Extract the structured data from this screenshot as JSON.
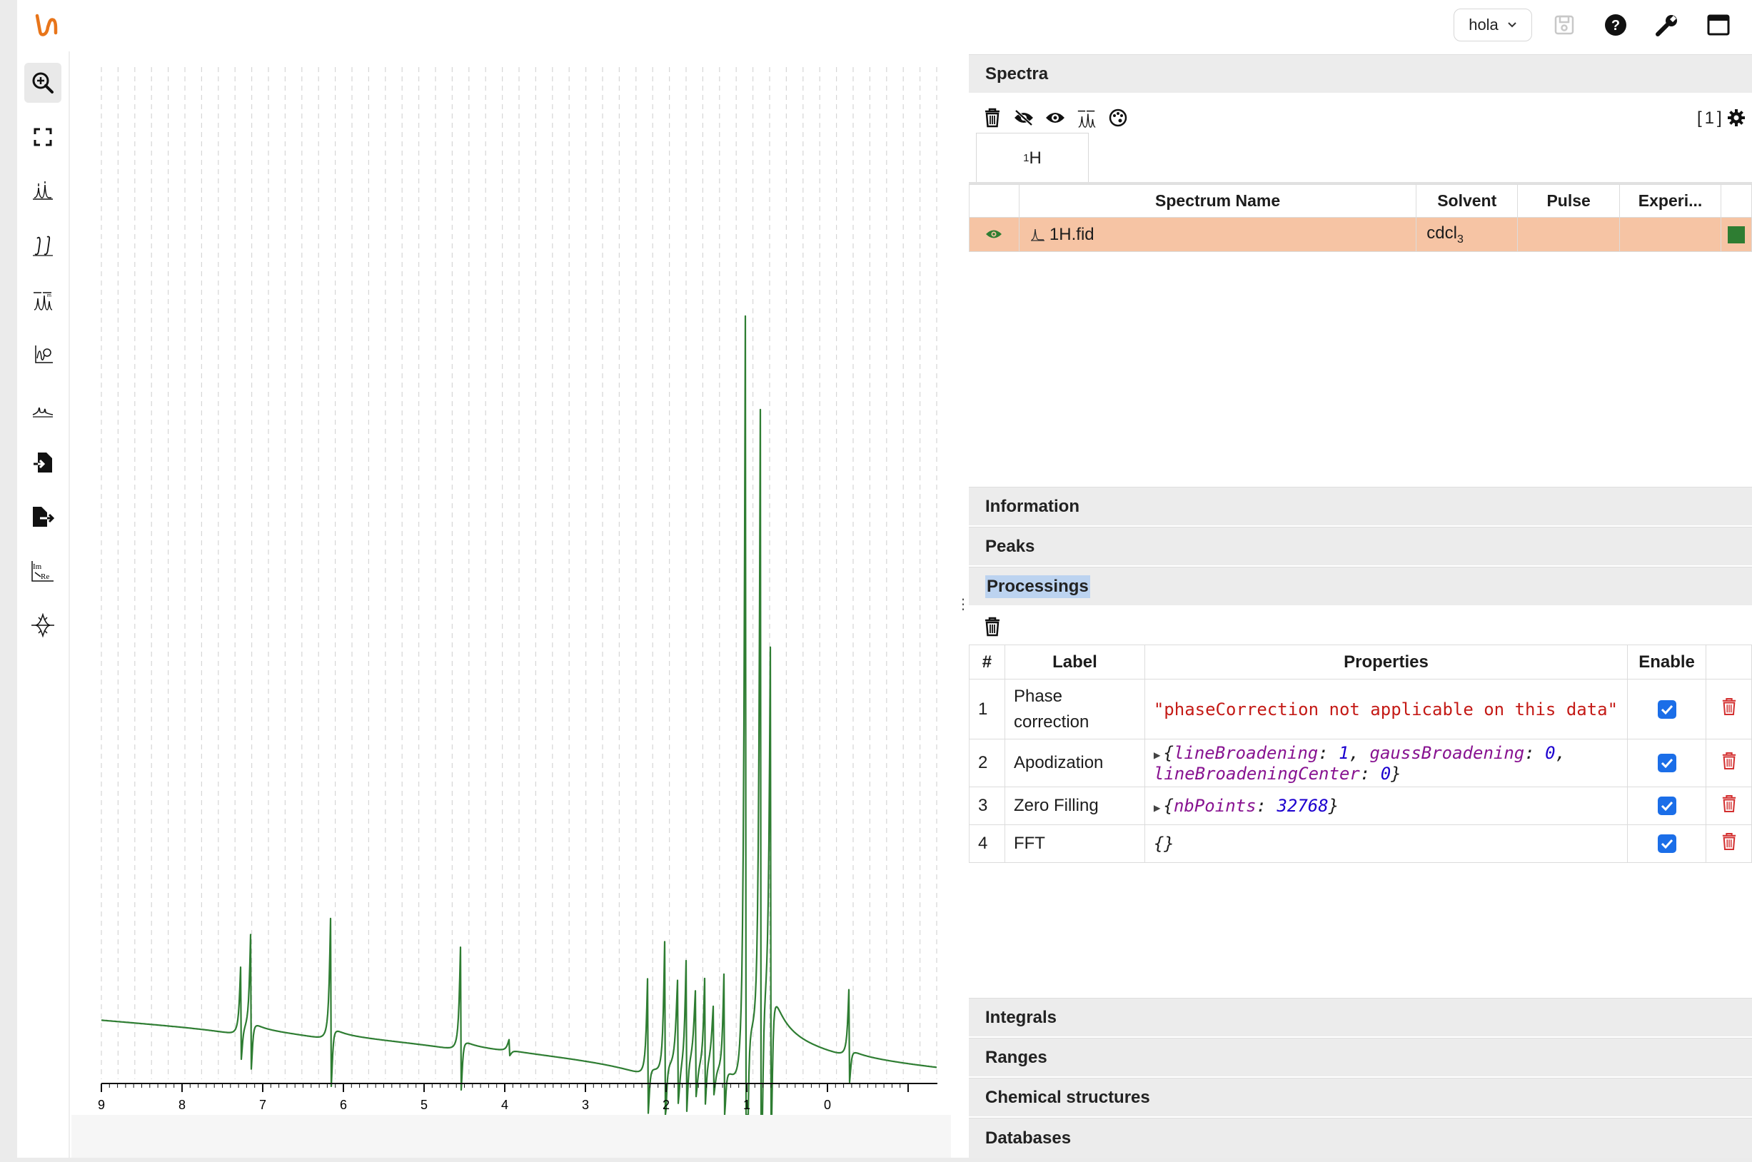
{
  "header": {
    "workspace_label": "hola",
    "icons": [
      "save-icon",
      "help-icon",
      "wrench-icon",
      "window-icon"
    ]
  },
  "toolbar": {
    "tools": [
      "zoom-tool",
      "full-zoom-tool",
      "peak-picking-tool",
      "integral-tool",
      "ranges-tool",
      "phase-correction-tool",
      "baseline-correction-tool",
      "import-tool",
      "export-tool",
      "real-imaginary-tool",
      "zero-filling-tool"
    ]
  },
  "spectrum": {
    "x_ticks": [
      "9",
      "8",
      "7",
      "6",
      "5",
      "4",
      "3",
      "2",
      "1",
      "0"
    ],
    "line_color": "#2e7d32"
  },
  "spectra_panel": {
    "title": "Spectra",
    "count": "[1]",
    "tab_nucleus_sup": "1",
    "tab_nucleus": "H",
    "columns": [
      "Spectrum Name",
      "Solvent",
      "Pulse",
      "Experi..."
    ],
    "rows": [
      {
        "name": "1H.fid",
        "solvent_base": "cdcl",
        "solvent_sub": "3",
        "pulse": "",
        "experiment": "",
        "color": "#2e7d32"
      }
    ]
  },
  "sections": {
    "information": "Information",
    "peaks": "Peaks",
    "processings": "Processings",
    "integrals": "Integrals",
    "ranges": "Ranges",
    "chemical_structures": "Chemical structures",
    "databases": "Databases"
  },
  "processings": {
    "columns": [
      "#",
      "Label",
      "Properties",
      "Enable"
    ],
    "rows": [
      {
        "index": "1",
        "label": "Phase correction",
        "error": "\"phaseCorrection not applicable on this data\"",
        "enabled": true
      },
      {
        "index": "2",
        "label": "Apodization",
        "k1": "lineBroadening",
        "v1": "1",
        "k2": "gaussBroadening",
        "v2": "0",
        "k3": "lineBroadeningCenter",
        "v3": "0",
        "enabled": true
      },
      {
        "index": "3",
        "label": "Zero Filling",
        "k1": "nbPoints",
        "v1": "32768",
        "enabled": true
      },
      {
        "index": "4",
        "label": "FFT",
        "empty": "{}",
        "enabled": true
      }
    ]
  }
}
